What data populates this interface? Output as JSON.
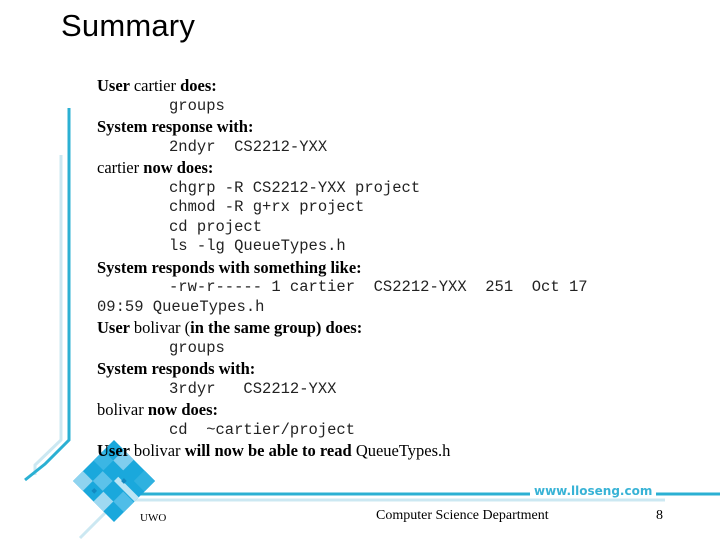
{
  "slide": {
    "title": "Summary",
    "lines": [
      {
        "type": "text",
        "parts": [
          {
            "t": "User ",
            "b": true
          },
          {
            "t": "cartier ",
            "b": false
          },
          {
            "t": "does:",
            "b": true
          }
        ]
      },
      {
        "type": "code",
        "text": "groups"
      },
      {
        "type": "text",
        "parts": [
          {
            "t": "System response with:",
            "b": true
          }
        ]
      },
      {
        "type": "code",
        "text": "2ndyr  CS2212-YXX"
      },
      {
        "type": "text",
        "parts": [
          {
            "t": "cartier ",
            "b": false
          },
          {
            "t": "now does:",
            "b": true
          }
        ]
      },
      {
        "type": "code",
        "text": "chgrp -R CS2212-YXX project"
      },
      {
        "type": "code",
        "text": "chmod -R g+rx project"
      },
      {
        "type": "code",
        "text": "cd project"
      },
      {
        "type": "code",
        "text": "ls -lg QueueTypes.h"
      },
      {
        "type": "text",
        "parts": [
          {
            "t": "System responds with something like:",
            "b": true
          }
        ]
      },
      {
        "type": "code",
        "text": "-rw-r----- 1 cartier  CS2212-YXX  251  Oct 17"
      },
      {
        "type": "code-noindent",
        "text": "09:59 QueueTypes.h"
      },
      {
        "type": "text",
        "parts": [
          {
            "t": "User ",
            "b": true
          },
          {
            "t": "bolivar (",
            "b": false
          },
          {
            "t": "in the same group) does:",
            "b": true
          }
        ]
      },
      {
        "type": "code",
        "text": "groups"
      },
      {
        "type": "text",
        "parts": [
          {
            "t": "System responds with:",
            "b": true
          }
        ]
      },
      {
        "type": "code",
        "text": "3rdyr   CS2212-YXX"
      },
      {
        "type": "text",
        "parts": [
          {
            "t": "bolivar ",
            "b": false
          },
          {
            "t": "now does:",
            "b": true
          }
        ]
      },
      {
        "type": "code",
        "text": "cd  ~cartier/project"
      },
      {
        "type": "text",
        "parts": [
          {
            "t": "User ",
            "b": true
          },
          {
            "t": "bolivar ",
            "b": false
          },
          {
            "t": "will now be able to read ",
            "b": true
          },
          {
            "t": "QueueTypes.h",
            "b": false
          }
        ]
      }
    ]
  },
  "footer": {
    "url": "www.lloseng.com",
    "left": "UWO",
    "center": "Computer Science Department",
    "page_number": "8"
  },
  "colors": {
    "accent": "#2bb0d3",
    "accent_light": "#cce8f2",
    "tile_dark": "#1aa8dc",
    "tile_light": "#8fd3ef"
  },
  "icons": {
    "logo": "blue-tiled-diamond-logo"
  }
}
